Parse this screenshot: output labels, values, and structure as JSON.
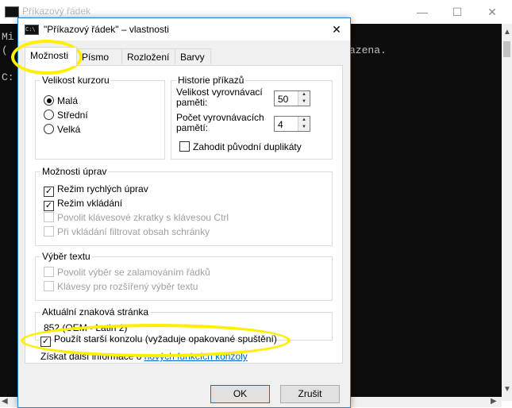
{
  "background_window": {
    "title": "Příkazový řádek",
    "console_lines": [
      "Mi",
      "(",
      "",
      "C:"
    ],
    "console_partial_text": "azena."
  },
  "dialog": {
    "icon_text": "C:\\",
    "title": "\"Příkazový řádek\" – vlastnosti",
    "tabs": [
      "Možnosti",
      "Písmo",
      "Rozložení",
      "Barvy"
    ],
    "active_tab": "Možnosti",
    "cursor_group": {
      "label": "Velikost kurzoru",
      "options": [
        "Malá",
        "Střední",
        "Velká"
      ],
      "selected": "Malá"
    },
    "history_group": {
      "label": "Historie příkazů",
      "buffer_size_label": "Velikost vyrovnávací paměti:",
      "buffer_size_value": "50",
      "buffer_count_label": "Počet vyrovnávacích pamětí:",
      "buffer_count_value": "4",
      "discard_duplicates_label": "Zahodit původní duplikáty"
    },
    "edit_group": {
      "label": "Možnosti úprav",
      "quick_edit": "Režim rychlých úprav",
      "insert_mode": "Režim vkládání",
      "ctrl_shortcuts": "Povolit klávesové zkratky s klávesou Ctrl",
      "filter_clipboard": "Při vkládání filtrovat obsah schránky"
    },
    "selection_group": {
      "label": "Výběr textu",
      "line_wrap": "Povolit výběr se zalamováním řádků",
      "extended_keys": "Klávesy pro rozšířený výběr textu"
    },
    "codepage_group": {
      "label": "Aktuální znaková stránka",
      "value": "852   (OEM - Latin 2)"
    },
    "legacy_console_label": "Použít starší konzolu (vyžaduje opakované spuštění)",
    "more_info_text": "Získat další informace o",
    "more_info_link": "nových funkcích konzoly",
    "ok_label": "OK",
    "cancel_label": "Zrušit"
  },
  "highlight_color": "#ffef00"
}
